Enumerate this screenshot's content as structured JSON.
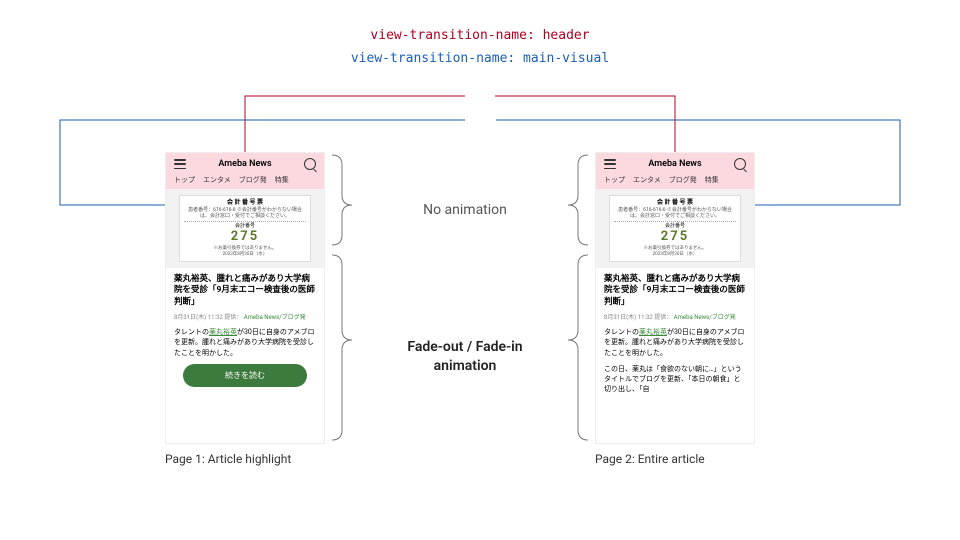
{
  "diagram": {
    "property_header": "view-transition-name: header",
    "property_visual": "view-transition-name: main-visual",
    "top_annotation": "No animation",
    "bottom_annotation": "Fade-out / Fade-in animation",
    "caption_page1": "Page 1: Article highlight",
    "caption_page2": "Page 2: Entire article"
  },
  "phone": {
    "brand": "Ameba News",
    "tabs": [
      "トップ",
      "エンタメ",
      "ブログ発",
      "特集"
    ],
    "ticket": {
      "title": "会 計 番 号 票",
      "sub": "患者番号：616-616-6  ※会計番号がわからない場合は、会計窓口・受付でご相談ください。",
      "label": "会計番号",
      "number": "275",
      "note": "※お薬引換券ではありません。",
      "date": "2023年8月30日（水）"
    },
    "article": {
      "title": "薬丸裕英、腫れと痛みがあり大学病院を受診「9月末エコー検査後の医師判断」",
      "meta_date": "8月31日(木) 11:32",
      "meta_provider": "提供：",
      "meta_source": "Ameba News/ブログ発",
      "excerpt_pre": "タレントの",
      "excerpt_link": "薬丸裕英",
      "excerpt_post": "が30日に自身のアメブロを更新。腫れと痛みがあり大学病院を受診したことを明かした。",
      "cta": "続きを読む",
      "more": "この日、薬丸は「食欲のない朝に…」というタイトルでブログを更新、「本日の朝食」と切り出し、「自"
    }
  },
  "colors": {
    "header_tint": "#fcd9de",
    "red": "#b00020",
    "blue": "#1a5fb4",
    "green": "#3d7a3d"
  }
}
